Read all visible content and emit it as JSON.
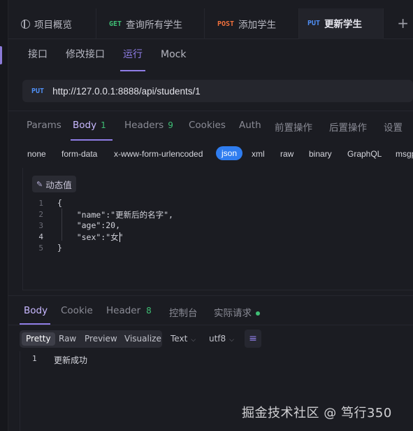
{
  "tabs": [
    {
      "method": "",
      "label": "项目概览",
      "icon": "overview-icon"
    },
    {
      "method": "GET",
      "label": "查询所有学生",
      "method_color": "#3fbf75"
    },
    {
      "method": "POST",
      "label": "添加学生",
      "method_color": "#f0703c"
    },
    {
      "method": "PUT",
      "label": "更新学生",
      "method_color": "#4f8ff5"
    }
  ],
  "new_tab_symbol": "+",
  "subtabs": [
    "接口",
    "修改接口",
    "运行",
    "Mock"
  ],
  "request": {
    "method": "PUT",
    "url": "http://127.0.0.1:8888/api/students/1"
  },
  "request_tabs": [
    {
      "label": "Params"
    },
    {
      "label": "Body",
      "count": "1"
    },
    {
      "label": "Headers",
      "count": "9"
    },
    {
      "label": "Cookies"
    },
    {
      "label": "Auth"
    },
    {
      "label": "前置操作"
    },
    {
      "label": "后置操作"
    },
    {
      "label": "设置"
    }
  ],
  "body_types": [
    "none",
    "form-data",
    "x-www-form-urlencoded",
    "json",
    "xml",
    "raw",
    "binary",
    "GraphQL",
    "msgp"
  ],
  "dynamic_value_label": "动态值",
  "editor_lines": [
    {
      "n": "1",
      "code": "{"
    },
    {
      "n": "2",
      "code": "    \"name\":\"更新后的名字\","
    },
    {
      "n": "3",
      "code": "    \"age\":20,"
    },
    {
      "n": "4",
      "code": "    \"sex\":\"女\""
    },
    {
      "n": "5",
      "code": "}"
    }
  ],
  "response_tabs": [
    {
      "label": "Body"
    },
    {
      "label": "Cookie"
    },
    {
      "label": "Header",
      "count": "8"
    },
    {
      "label": "控制台"
    },
    {
      "label": "实际请求"
    }
  ],
  "view_modes": [
    "Pretty",
    "Raw",
    "Preview",
    "Visualize"
  ],
  "format_select": "Text",
  "encoding_select": "utf8",
  "response_lines": [
    {
      "n": "1",
      "text": "更新成功"
    }
  ],
  "watermark": "掘金技术社区 @ 笃行350",
  "colors": {
    "accent": "#8f7de6",
    "selected_body_type": "#2f7df0",
    "success_count": "#3fbf75"
  }
}
